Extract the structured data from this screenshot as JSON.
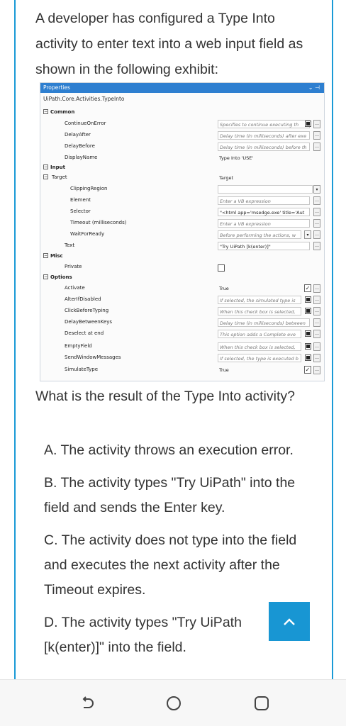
{
  "question_text": "A developer has configured a Type Into activity to enter text into a web input field as shown in the following exhibit:",
  "properties_panel": {
    "header_title": "Properties",
    "header_controls": "⌄ ⊣",
    "activity_type": "UiPath.Core.Activities.TypeInto",
    "rows": [
      {
        "name": "Common",
        "category": true
      },
      {
        "name": "ContinueOnError",
        "value": "Specifies to continue executing th"
      },
      {
        "name": "DelayAfter",
        "value": "Delay time (in milliseconds) after exe"
      },
      {
        "name": "DelayBefore",
        "value": "Delay time (in milliseconds) before th"
      },
      {
        "name": "DisplayName",
        "value": "Type Into 'USE'"
      },
      {
        "name": "Input",
        "category": true
      },
      {
        "name": "Target",
        "value": "Target"
      },
      {
        "name": "ClippingRegion",
        "value": ""
      },
      {
        "name": "Element",
        "value": "Enter a VB expression"
      },
      {
        "name": "Selector",
        "value": "\"<html app='msedge.exe' title='Aut"
      },
      {
        "name": "Timeout (milliseconds)",
        "value": "Enter a VB expression"
      },
      {
        "name": "WaitForReady",
        "value": "Before performing the actions, w"
      },
      {
        "name": "Text",
        "value": "\"Try UiPath [k(enter)]\""
      },
      {
        "name": "Misc",
        "category": true
      },
      {
        "name": "Private",
        "value": ""
      },
      {
        "name": "Options",
        "category": true
      },
      {
        "name": "Activate",
        "value": "True"
      },
      {
        "name": "AlterIfDisabled",
        "value": "If selected, the simulated type is"
      },
      {
        "name": "ClickBeforeTyping",
        "value": "When this check box is selected,"
      },
      {
        "name": "DelayBetweenKeys",
        "value": "Delay time (in milliseconds) between"
      },
      {
        "name": "Deselect at end",
        "value": "This option adds a Complete eve"
      },
      {
        "name": "EmptyField",
        "value": "When this check box is selected,"
      },
      {
        "name": "SendWindowMessages",
        "value": "If selected, the type is executed b"
      },
      {
        "name": "SimulateType",
        "value": "True"
      }
    ]
  },
  "prompt": "What is the result of the Type Into activity?",
  "answers": [
    "A. The activity throws an execution error.",
    "B. The activity types \"Try UiPath\" into the field and sends the Enter key.",
    "C. The activity does not type into the field and executes the next activity after the Timeout expires.",
    "D. The activity types \"Try UiPath [k(enter)]\" into the field."
  ],
  "colors": {
    "accent": "#1a9ad6",
    "header_blue": "#2e7fd0"
  },
  "icons": {
    "scroll_top": "chevron-up-icon",
    "nav_back": "back-icon",
    "nav_home": "home-icon",
    "nav_recents": "recents-icon"
  }
}
